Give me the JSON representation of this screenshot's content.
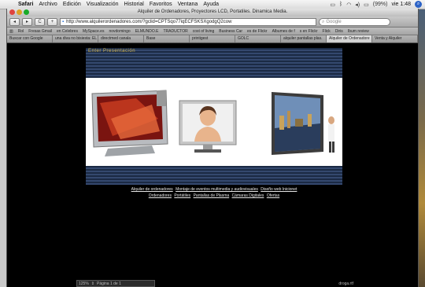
{
  "menubar": {
    "apple_glyph": "",
    "items": [
      "Safari",
      "Archivo",
      "Edición",
      "Visualización",
      "Historial",
      "Favoritos",
      "Ventana",
      "Ayuda"
    ],
    "battery": "(99%)",
    "clock": "vie 1:48"
  },
  "window": {
    "title": "Alquiler de Ordenadores, Proyectores LCD, Portatiles. Dinamica Media."
  },
  "toolbar": {
    "back": "◂",
    "forward": "▸",
    "reload": "C",
    "add": "+",
    "url": "http://www.alquilerordenadores.com/?gclid=CPTSqo77iqECFSKSXgodgQ2cow",
    "search_placeholder": "Google"
  },
  "bookmarks": [
    "Rol",
    "Fresas Gmail",
    "en Celebres",
    "MySpace.es",
    "novdomingo",
    "ELMUNDO.E",
    "TRADUCTOR",
    "cost of living",
    "Business Car",
    "es de Flickr",
    "Albumes de f",
    "s en Flickr",
    "Flick",
    "Diris",
    "Ibum review"
  ],
  "tabs": [
    "Buscar con Google",
    "una diva no bisiesta: EL",
    "directmed canala",
    "Base",
    "printigest",
    "GOLC",
    "alquiler pantallas plas.",
    "Alquiler de Ordenadore",
    "Venta y Alquiler"
  ],
  "page": {
    "banner_caption": "Enter Presentación",
    "links_line1": [
      "Alquiler de ordenadores",
      "Montaje de eventos multimedia y audiovisuales",
      "Diseño web Inicionet"
    ],
    "links_line2": [
      "Ordenadores",
      "Portátiles",
      "Pantallas de Plasma",
      "Cámaras Digitales",
      "Ofertas"
    ]
  },
  "statusbar": {
    "zoom": "125%",
    "page_indicator": "Página 1 de 1",
    "file": "droga.rtf"
  },
  "colors": {
    "banner_dark": "#1b2a44",
    "banner_light": "#34486e",
    "caption_gold": "#d2b24a",
    "page_bg": "#000000"
  }
}
